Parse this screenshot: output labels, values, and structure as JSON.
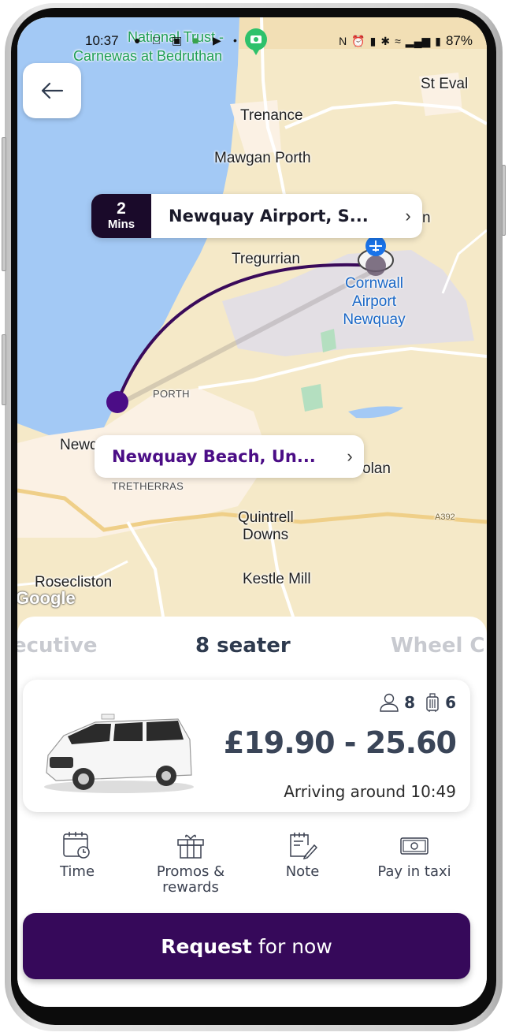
{
  "status_bar": {
    "time": "10:37",
    "battery": "87%",
    "icons_left": [
      "location-icon",
      "instagram-icon",
      "calendar-icon",
      "messages-icon",
      "youtube-icon",
      "dot-icon"
    ],
    "icons_right": [
      "nfc-icon",
      "alarm-icon",
      "vibrate-icon",
      "bluetooth-icon",
      "wifi-icon",
      "signal-icon",
      "battery-icon"
    ]
  },
  "map": {
    "poi": {
      "name_line1": "National Trust -",
      "name_line2": "Carnewas at Bedruthan",
      "icon": "camera-pin-icon"
    },
    "labels": {
      "st_eval": "St Eval",
      "trenance": "Trenance",
      "mawgan_porth": "Mawgan Porth",
      "tregurrian": "Tregurrian",
      "airport_l1": "Cornwall",
      "airport_l2": "Airport",
      "airport_l3": "Newquay",
      "porth": "PORTH",
      "newquay": "Newq",
      "tretherras": "TRETHERRAS",
      "colan": "olan",
      "quintrell_l1": "Quintrell",
      "quintrell_l2": "Downs",
      "rosecliston": "Rosecliston",
      "kestle_mill": "Kestle Mill",
      "road_a392": "A392",
      "edge_n": "n"
    },
    "attribution": "Google",
    "pickup": {
      "eta_number": "2",
      "eta_unit": "Mins",
      "label": "Newquay Airport, S..."
    },
    "dropoff": {
      "label": "Newquay Beach, Un..."
    },
    "colors": {
      "route": "#3a0a5a",
      "dropoff_text": "#4b0d86",
      "sea": "#a3c9f5",
      "land": "#f5e9c8"
    }
  },
  "back_button": {
    "icon": "arrow-left-icon"
  },
  "vehicle_tabs": [
    {
      "label": "ecutive",
      "active": false
    },
    {
      "label": "8 seater",
      "active": true
    },
    {
      "label": "Wheel C",
      "active": false
    }
  ],
  "vehicle_card": {
    "passengers": "8",
    "luggage": "6",
    "price": "£19.90 - 25.60",
    "arrival": "Arriving around 10:49"
  },
  "actions": [
    {
      "label": "Time",
      "icon": "calendar-clock-icon"
    },
    {
      "label": "Promos & rewards",
      "icon": "gift-icon"
    },
    {
      "label": "Note",
      "icon": "note-edit-icon"
    },
    {
      "label": "Pay in taxi",
      "icon": "cash-icon"
    }
  ],
  "request_button": {
    "bold": "Request",
    "rest": "for now",
    "color": "#36095a"
  }
}
